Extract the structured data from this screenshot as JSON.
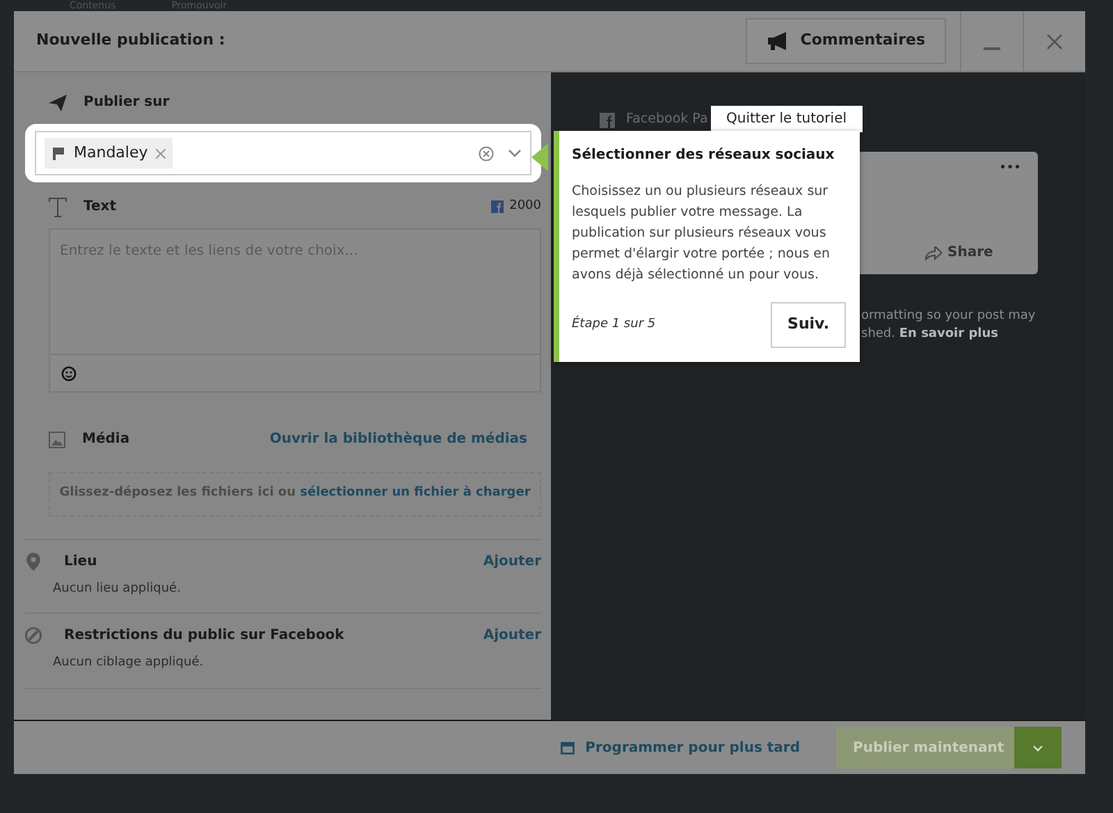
{
  "background_nav": [
    "Contenus",
    "Promouvoir"
  ],
  "header": {
    "title": "Nouvelle publication :",
    "comments_button": "Commentaires"
  },
  "publish_on": {
    "label": "Publier sur",
    "tags": [
      {
        "label": "Mandaley"
      }
    ]
  },
  "text": {
    "label": "Text",
    "count": "2000",
    "placeholder": "Entrez le texte et les liens de votre choix..."
  },
  "media": {
    "label": "Média",
    "library_link": "Ouvrir la bibliothèque de médias",
    "drop_text": "Glissez-déposez les fichiers ici ou",
    "drop_link": "sélectionner un fichier à charger"
  },
  "sections": [
    {
      "kind": "location",
      "title": "Lieu",
      "action": "Ajouter",
      "note": "Aucun lieu appliqué."
    },
    {
      "kind": "audience",
      "title": "Restrictions du public sur Facebook",
      "action": "Ajouter",
      "note": "Aucun ciblage appliqué."
    }
  ],
  "preview": {
    "network": "Facebook Pa",
    "menu": "•••",
    "share": "Share",
    "note_lines": [
      "ormatting so your post may",
      "shed. **En savoir plus**"
    ]
  },
  "tutorial": {
    "quit": "Quitter le tutoriel",
    "title": "Sélectionner des réseaux sociaux",
    "body": "Choisissez un ou plusieurs réseaux sur lesquels publier votre message. La publication sur plusieurs réseaux vous permet d'élargir votre portée ; nous en avons déjà sélectionné un pour vous.",
    "step": "Étape 1 sur 5",
    "next": "Suiv."
  },
  "footer": {
    "schedule": "Programmer pour plus tard",
    "publish": "Publier maintenant",
    "publish_disabled": true
  }
}
